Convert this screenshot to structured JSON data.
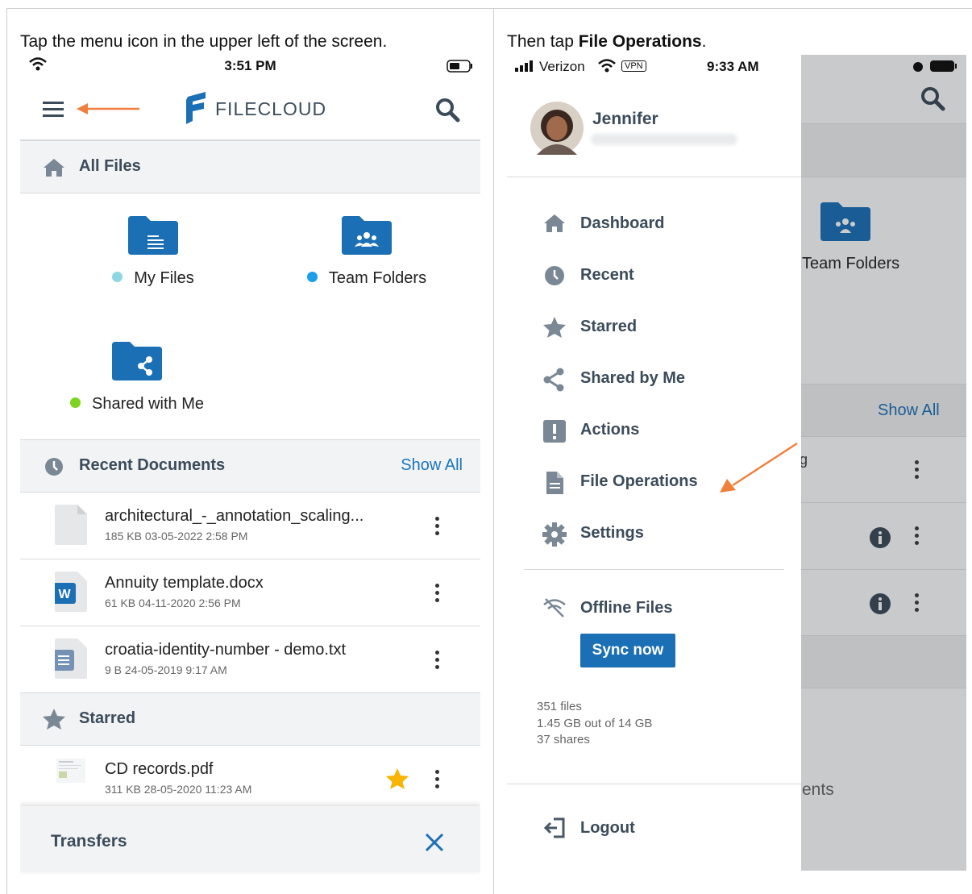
{
  "captions": {
    "left": "Tap the menu icon in the upper left of the screen.",
    "right_prefix": "Then tap ",
    "right_bold": "File Operations",
    "right_suffix": "."
  },
  "left_phone": {
    "status_time": "3:51 PM",
    "brand": "FILECLOUD",
    "all_files_label": "All Files",
    "tiles": [
      {
        "label": "My Files",
        "dot_color": "#8fd6e3",
        "icon": "folder-document-icon"
      },
      {
        "label": "Team Folders",
        "dot_color": "#1a9ee8",
        "icon": "folder-team-icon"
      },
      {
        "label": "Shared with Me",
        "dot_color": "#7ed321",
        "icon": "folder-share-icon"
      }
    ],
    "recent_label": "Recent Documents",
    "show_all": "Show All",
    "recent_files": [
      {
        "name": "architectural_-_annotation_scaling...",
        "meta": "185 KB 03-05-2022 2:58 PM",
        "icon": "blank-file-icon"
      },
      {
        "name": "Annuity template.docx",
        "meta": "61 KB 04-11-2020 2:56 PM",
        "icon": "word-file-icon"
      },
      {
        "name": "croatia-identity-number - demo.txt",
        "meta": "9 B 24-05-2019 9:17 AM",
        "icon": "text-file-icon"
      }
    ],
    "starred_label": "Starred",
    "starred_files": [
      {
        "name": "CD records.pdf",
        "meta": "311 KB 28-05-2020 11:23 AM",
        "icon": "pdf-thumbnail-icon"
      }
    ],
    "transfers_label": "Transfers",
    "accent": "#1b75bc",
    "arrow_color": "#f07f3c"
  },
  "right_phone": {
    "carrier": "Verizon",
    "vpn": "VPN",
    "status_time": "9:33 AM",
    "user_name": "Jennifer",
    "menu": [
      {
        "label": "Dashboard",
        "icon": "home-icon"
      },
      {
        "label": "Recent",
        "icon": "clock-icon"
      },
      {
        "label": "Starred",
        "icon": "star-icon"
      },
      {
        "label": "Shared by Me",
        "icon": "share-icon"
      },
      {
        "label": "Actions",
        "icon": "alert-icon"
      },
      {
        "label": "File Operations",
        "icon": "file-icon"
      },
      {
        "label": "Settings",
        "icon": "gear-icon"
      }
    ],
    "offline_label": "Offline Files",
    "sync_label": "Sync now",
    "stats": [
      "351 files",
      "1.45 GB out of 14 GB",
      "37 shares"
    ],
    "logout_label": "Logout",
    "bg_team_folders": "Team Folders",
    "bg_show_all": "Show All",
    "bg_partial_text": "ents",
    "bg_partial_char": "g"
  }
}
